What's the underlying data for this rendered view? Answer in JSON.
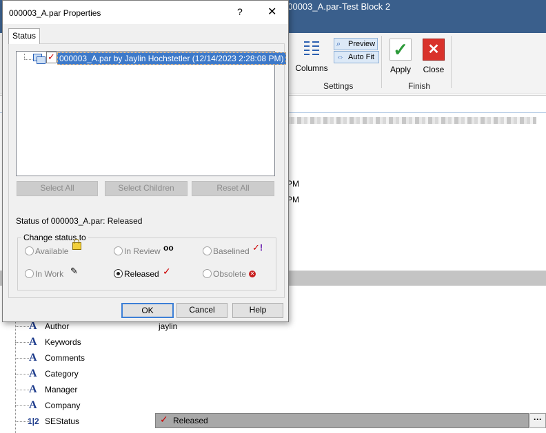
{
  "app": {
    "window_title": "000003_A.par-Test Block 2",
    "ribbon": {
      "columns_label": "Columns",
      "preview_label": "Preview",
      "autofit_label": "Auto Fit",
      "apply_label": "Apply",
      "close_label": "Close",
      "group_settings": "Settings",
      "group_finish": "Finish"
    },
    "pm_1": "PM",
    "pm_2": "PM",
    "properties": [
      {
        "label": "Author",
        "value": "jaylin",
        "icon": "text-A-icon"
      },
      {
        "label": "Keywords",
        "value": "",
        "icon": "text-A-icon"
      },
      {
        "label": "Comments",
        "value": "",
        "icon": "text-A-icon"
      },
      {
        "label": "Category",
        "value": "",
        "icon": "text-A-icon"
      },
      {
        "label": "Manager",
        "value": "",
        "icon": "text-A-icon"
      },
      {
        "label": "Company",
        "value": "",
        "icon": "text-A-icon"
      },
      {
        "label": "SEStatus",
        "value": "Released",
        "icon": "number-icon"
      }
    ],
    "number_icon_glyph": "1|2",
    "more_button": "···"
  },
  "dialog": {
    "title": "000003_A.par Properties",
    "help_glyph": "?",
    "close_glyph": "✕",
    "tab_status": "Status",
    "tree_item": "000003_A.par by Jaylin Hochstetler (12/14/2023 2:28:08 PM)",
    "select_all": "Select All",
    "select_children": "Select Children",
    "reset_all": "Reset All",
    "status_of": "Status of 000003_A.par:  Released",
    "change_status_to": "Change status to",
    "options": {
      "available": "Available",
      "in_review": "In Review",
      "baselined": "Baselined",
      "in_work": "In Work",
      "released": "Released",
      "obsolete": "Obsolete"
    },
    "selected_option": "released",
    "ok": "OK",
    "cancel": "Cancel",
    "help": "Help"
  },
  "colors": {
    "title_bar": "#3a5f8c",
    "selection": "#3d79c9",
    "released_check": "#cc0000",
    "close_red": "#d9322b",
    "apply_green": "#2d9a3a"
  }
}
